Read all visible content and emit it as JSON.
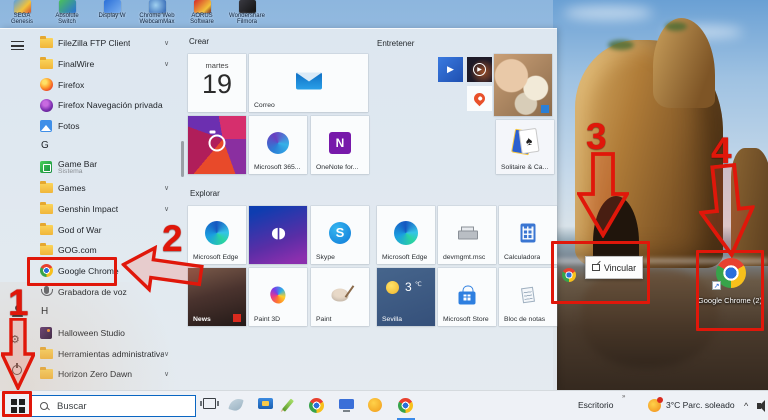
{
  "colors": {
    "annotation_red": "#e0170a",
    "search_border": "#0a66c2",
    "menu_bg": "#e3eaf0",
    "taskbar_bg": "#eef1f6"
  },
  "icons": {
    "chevron_down": "∨",
    "play": "▶",
    "spade": "♠",
    "dolby": "◖◗",
    "gear": "⚙",
    "tray_chevron": "^",
    "shortcut_arrow": "↗"
  },
  "desktop": {
    "top_icons": [
      {
        "name": "desktop-icon-1",
        "line1": "SEGA",
        "line2": "Genesis"
      },
      {
        "name": "desktop-icon-2",
        "line1": "Absolute",
        "line2": "Switch"
      },
      {
        "name": "desktop-icon-3",
        "line1": "Display W",
        "line2": ""
      },
      {
        "name": "desktop-icon-4",
        "line1": "Chrome Web",
        "line2": "WebcamMax"
      },
      {
        "name": "desktop-icon-5",
        "line1": "AORUS",
        "line2": "Software"
      },
      {
        "name": "desktop-icon-6",
        "line1": "Wondershare",
        "line2": "Filmora"
      }
    ],
    "shortcut_label": "Google Chrome (2)",
    "drag_tooltip_label": "Vincular"
  },
  "annotations": {
    "step1": "1",
    "step2": "2",
    "step3": "3",
    "step4": "4"
  },
  "start_menu": {
    "app_list": [
      {
        "type": "app",
        "label": "FileZilla FTP Client",
        "icon": "folder",
        "chevron": true
      },
      {
        "type": "app",
        "label": "FinalWire",
        "icon": "folder",
        "chevron": true
      },
      {
        "type": "app",
        "label": "Firefox",
        "icon": "firefox"
      },
      {
        "type": "app",
        "label": "Firefox Navegación privada",
        "icon": "ffpriv"
      },
      {
        "type": "app",
        "label": "Fotos",
        "icon": "photos"
      },
      {
        "type": "letter",
        "label": "G"
      },
      {
        "type": "app",
        "label": "Game Bar",
        "sub": "Sistema",
        "icon": "gamebar"
      },
      {
        "type": "app",
        "label": "Games",
        "icon": "folder",
        "chevron": true
      },
      {
        "type": "app",
        "label": "Genshin Impact",
        "icon": "folder",
        "chevron": true
      },
      {
        "type": "app",
        "label": "God of War",
        "icon": "folder"
      },
      {
        "type": "app",
        "label": "GOG.com",
        "icon": "folder"
      },
      {
        "type": "app",
        "label": "Google Chrome",
        "icon": "chrome",
        "highlight": true
      },
      {
        "type": "app",
        "label": "Grabadora de voz",
        "icon": "mic"
      },
      {
        "type": "letter",
        "label": "H"
      },
      {
        "type": "app",
        "label": "Halloween Studio",
        "icon": "hallow"
      },
      {
        "type": "app",
        "label": "Herramientas administrativas de...",
        "icon": "folder",
        "chevron": true
      },
      {
        "type": "app",
        "label": "Horizon Zero Dawn",
        "icon": "folder",
        "chevron": true
      }
    ],
    "groups": {
      "crear": {
        "header": "Crear",
        "calendar": {
          "weekday": "martes",
          "day": "19"
        },
        "correo_label": "Correo",
        "m365_label": "Microsoft 365...",
        "onenote_label": "OneNote for..."
      },
      "entretener": {
        "header": "Entretener",
        "solitaire_label": "Solitaire & Ca..."
      },
      "explorar": {
        "header": "Explorar",
        "edge_label": "Microsoft Edge",
        "edge2_label": "Microsoft Edge",
        "skype_label": "Skype",
        "devmgmt_label": "devmgmt.msc",
        "calculadora_label": "Calculadora",
        "news_label": "News",
        "paint3d_label": "Paint 3D",
        "paint_label": "Paint",
        "sevilla": {
          "label": "Sevilla",
          "temp": "3",
          "unit": "℃"
        },
        "store_label": "Microsoft Store",
        "notepad_label": "Bloc de notas"
      }
    }
  },
  "taskbar": {
    "search_placeholder": "Buscar",
    "tray": {
      "desktop_label": "Escritorio",
      "desktop_chevron": "»",
      "weather": "3°C  Parc. soleado"
    }
  }
}
